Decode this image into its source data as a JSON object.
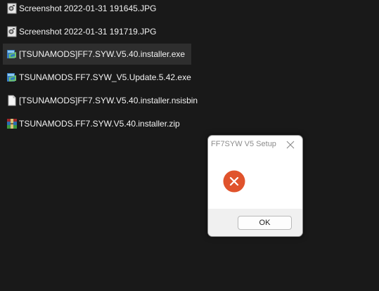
{
  "files": [
    {
      "name": "Screenshot 2022-01-31 191645.JPG",
      "icon": "jpg-image-icon"
    },
    {
      "name": "Screenshot 2022-01-31 191719.JPG",
      "icon": "jpg-image-icon"
    },
    {
      "name": "[TSUNAMODS]FF7.SYW.V5.40.installer.exe",
      "icon": "installer-exe-icon",
      "selected": true
    },
    {
      "name": "TSUNAMODS.FF7.SYW_V5.Update.5.42.exe",
      "icon": "installer-exe-icon"
    },
    {
      "name": "[TSUNAMODS]FF7.SYW.V5.40.installer.nsisbin",
      "icon": "generic-file-icon"
    },
    {
      "name": "TSUNAMODS.FF7.SYW.V5.40.installer.zip",
      "icon": "winrar-archive-icon"
    }
  ],
  "dialog": {
    "title": "FF7SYW V5 Setup",
    "icon": "error-icon",
    "ok_label": "OK"
  },
  "colors": {
    "background": "#191919",
    "selected_row": "#2e2e2e",
    "error_red": "#e0532c",
    "dialog_footer": "#f0f0f0"
  }
}
